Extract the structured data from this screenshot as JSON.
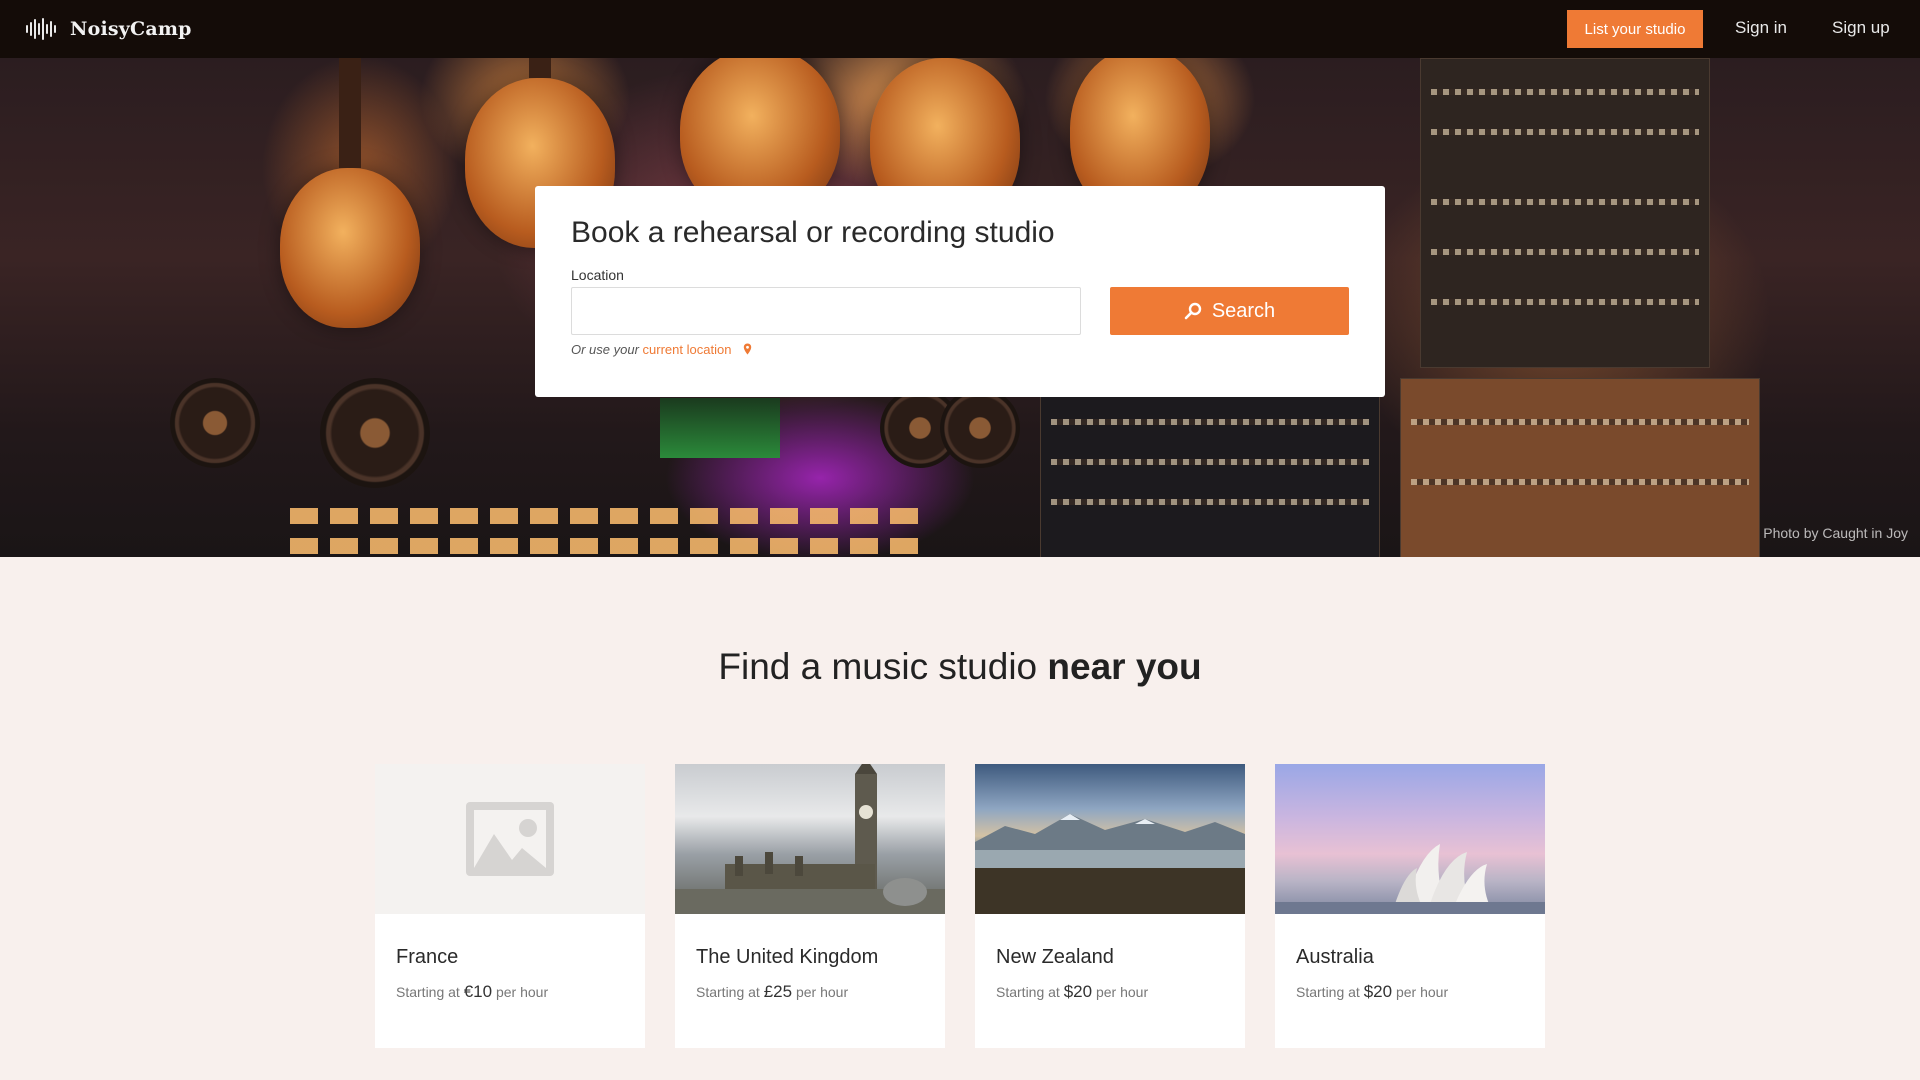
{
  "nav": {
    "brand": "NoisyCamp",
    "cta_label": "List your studio",
    "signin_label": "Sign in",
    "signup_label": "Sign up"
  },
  "hero": {
    "photo_credit": "Photo by Caught in Joy"
  },
  "search": {
    "title": "Book a rehearsal or recording studio",
    "location_label": "Location",
    "location_value": "",
    "location_placeholder": "",
    "button_label": "Search",
    "helper_prefix": "Or use your",
    "helper_link": "current location"
  },
  "section": {
    "title_prefix": "Find a music studio",
    "title_bold": "near you"
  },
  "countries": [
    {
      "name": "France",
      "price_prefix": "Starting at",
      "price": "€10",
      "price_suffix": "per hour",
      "image": "placeholder-image-icon"
    },
    {
      "name": "The United Kingdom",
      "price_prefix": "Starting at",
      "price": "£25",
      "price_suffix": "per hour",
      "image": "big-ben-photo"
    },
    {
      "name": "New Zealand",
      "price_prefix": "Starting at",
      "price": "$20",
      "price_suffix": "per hour",
      "image": "lake-mountains-photo"
    },
    {
      "name": "Australia",
      "price_prefix": "Starting at",
      "price": "$20",
      "price_suffix": "per hour",
      "image": "sydney-opera-house-photo"
    }
  ],
  "colors": {
    "accent": "#ef7a35",
    "nav_bg": "#140c08",
    "page_bg": "#f8f0ed"
  }
}
